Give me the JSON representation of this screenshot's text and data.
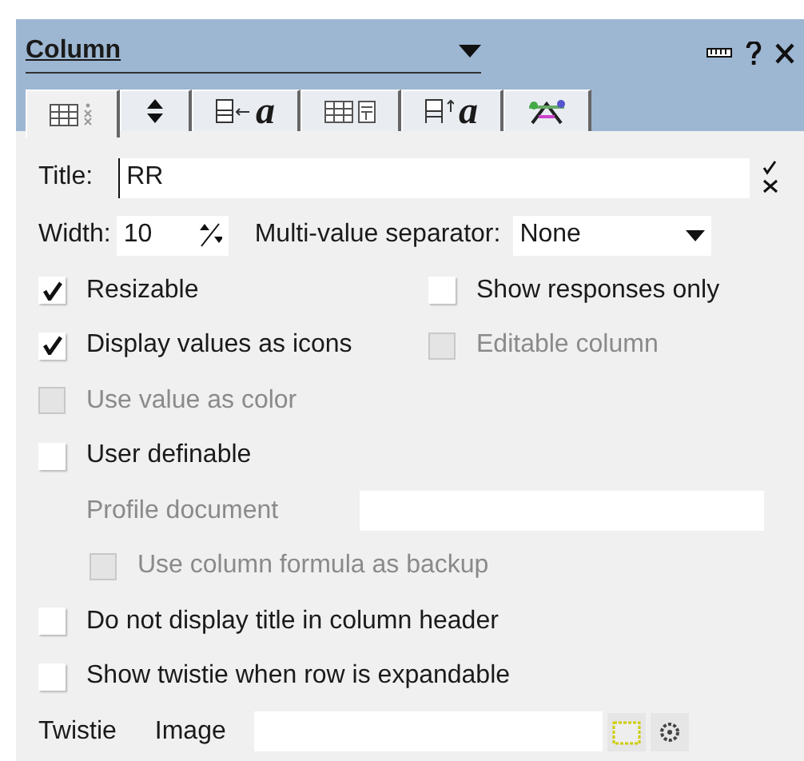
{
  "panel": {
    "title": "Column"
  },
  "tabs": [
    {
      "kind": "column-info",
      "selected": true
    },
    {
      "kind": "sort",
      "selected": false
    },
    {
      "kind": "value",
      "label": "a",
      "selected": false
    },
    {
      "kind": "style",
      "selected": false
    },
    {
      "kind": "header",
      "label": "a",
      "selected": false
    },
    {
      "kind": "advanced",
      "selected": false
    }
  ],
  "title_field": {
    "label": "Title:",
    "value": "RR"
  },
  "width_field": {
    "label": "Width:",
    "value": "10"
  },
  "separator": {
    "label": "Multi-value separator:",
    "value": "None"
  },
  "rows": [
    {
      "kind": "pair",
      "items": [
        {
          "label": "Resizable",
          "checked": true,
          "disabled": false
        },
        {
          "label": "Show responses only",
          "checked": false,
          "disabled": false
        }
      ]
    },
    {
      "kind": "pair",
      "items": [
        {
          "label": "Display values as icons",
          "checked": true,
          "disabled": false
        },
        {
          "label": "Editable column",
          "checked": false,
          "disabled": true
        }
      ]
    },
    {
      "kind": "checkbox",
      "label": "Use value as color",
      "checked": false,
      "disabled": true
    },
    {
      "kind": "checkbox",
      "label": "User definable",
      "checked": false,
      "disabled": false
    },
    {
      "kind": "field",
      "label": "Profile document",
      "disabled": true
    },
    {
      "kind": "sub-checkbox",
      "label": "Use column formula as backup",
      "checked": false,
      "disabled": true
    },
    {
      "kind": "checkbox",
      "label": "Do not display title in column header",
      "checked": false,
      "disabled": false
    },
    {
      "kind": "checkbox",
      "label": "Show twistie when row is expandable",
      "checked": false,
      "disabled": false
    },
    {
      "kind": "image",
      "label": "Twistie",
      "sublabel": "Image"
    }
  ]
}
